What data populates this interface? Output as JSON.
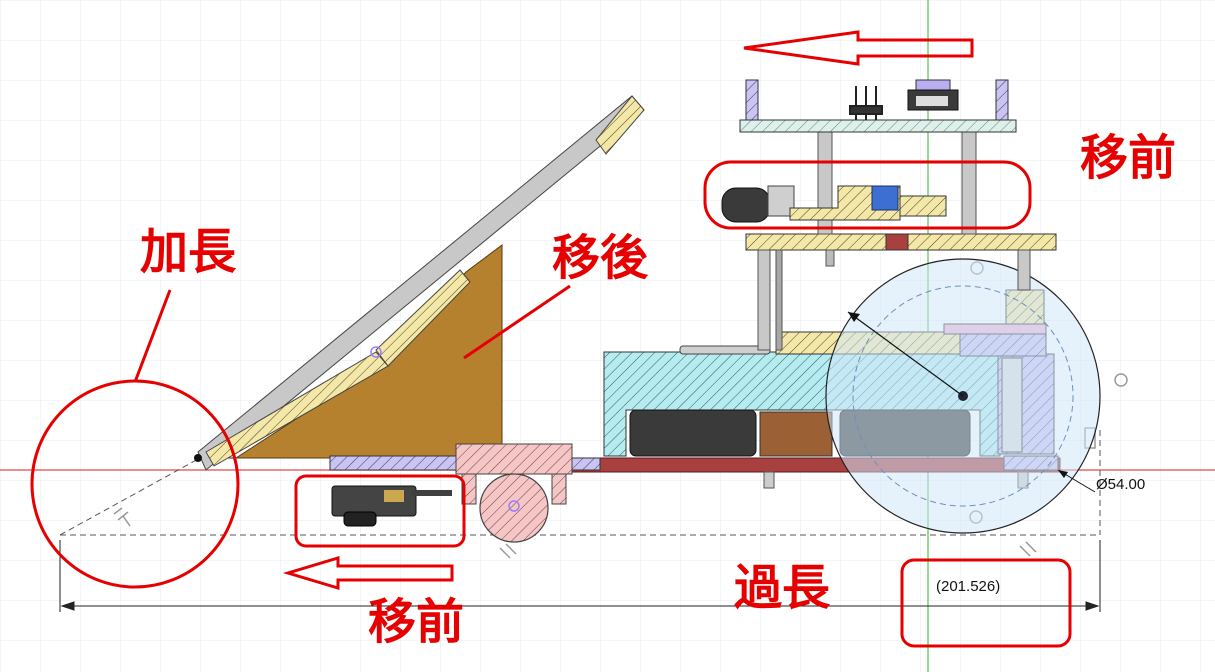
{
  "annotations": {
    "lengthen": "加長",
    "moved_back": "移後",
    "moved_forward_top": "移前",
    "moved_forward_bottom": "移前",
    "too_long": "過長"
  },
  "dimensions": {
    "wheel_diameter": "Ø54.00",
    "overall_length": "(201.526)"
  },
  "colors": {
    "annotation_red": "#e60000",
    "grid": "#e3e8ef",
    "x_axis": "#e04a4a",
    "y_axis": "#53c153",
    "hatch_yellow": "#f4e8a8",
    "hatch_cyan": "#b6ecef",
    "hatch_pink": "#f5c6c6",
    "hatch_lavender": "#c9c4f1",
    "scoop_brown": "#b5812e",
    "board_green": "#ddf0ea",
    "wheel_fill": "#cfe6f8"
  }
}
